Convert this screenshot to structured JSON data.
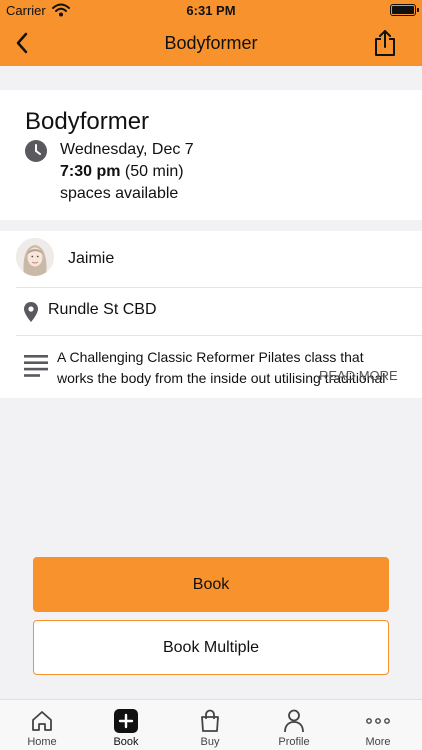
{
  "status_bar": {
    "carrier": "Carrier",
    "time": "6:31 PM"
  },
  "nav": {
    "title": "Bodyformer",
    "back_icon": "chevron-left-icon",
    "share_icon": "share-icon"
  },
  "class": {
    "title": "Bodyformer",
    "date": "Wednesday, Dec 7",
    "time": "7:30 pm",
    "duration": "(50 min)",
    "spaces": "spaces available"
  },
  "details": {
    "instructor": "Jaimie",
    "location": "Rundle St CBD",
    "description": "A Challenging Classic Reformer Pilates class that works the body from the inside out utilising traditional",
    "read_more": "READ MORE"
  },
  "actions": {
    "book": "Book",
    "book_multiple": "Book Multiple"
  },
  "tabs": [
    {
      "label": "Home",
      "icon": "home-icon"
    },
    {
      "label": "Book",
      "icon": "plus-square-icon"
    },
    {
      "label": "Buy",
      "icon": "shopping-bag-icon"
    },
    {
      "label": "Profile",
      "icon": "person-icon"
    },
    {
      "label": "More",
      "icon": "more-dots-icon"
    }
  ],
  "colors": {
    "accent": "#f7922d",
    "background": "#f2f2f4"
  }
}
